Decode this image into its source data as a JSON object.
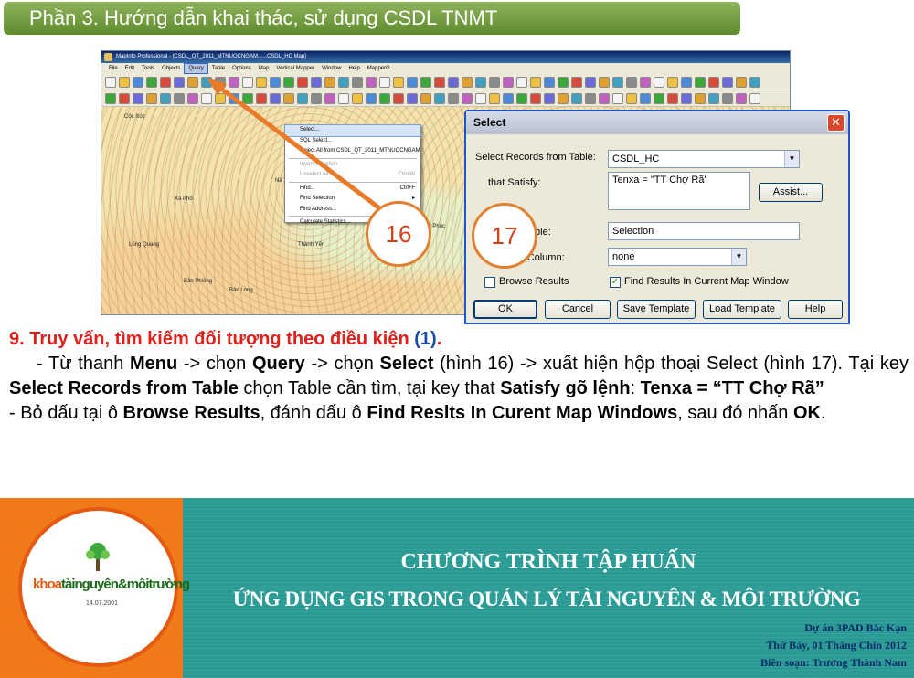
{
  "slide": {
    "title": "Phần 3. Hướng dẫn khai thác, sử dụng CSDL TNMT"
  },
  "app": {
    "window_title": "MapInfo Professional - [CSDL_QT_2011_MTNUOCNGAM,.....CSDL_HC Map]",
    "menu": [
      "File",
      "Edit",
      "Tools",
      "Objects",
      "Query",
      "Table",
      "Options",
      "Map",
      "Vertical Mapper",
      "Window",
      "Help",
      "MapperG"
    ],
    "active_menu": "Query",
    "query_menu_items": [
      {
        "label": "Select...",
        "shortcut": "",
        "disabled": false,
        "highlight": true
      },
      {
        "label": "SQL Select...",
        "shortcut": "",
        "disabled": false,
        "highlight": false
      },
      {
        "label": "Select All from CSDL_QT_2011_MTNUOCNGAM",
        "shortcut": "",
        "disabled": false,
        "highlight": false
      },
      {
        "label": "Invert Selection",
        "shortcut": "",
        "disabled": true,
        "highlight": false
      },
      {
        "label": "Unselect All",
        "shortcut": "Ctrl+W",
        "disabled": true,
        "highlight": false
      },
      {
        "label": "Find...",
        "shortcut": "Ctrl+F",
        "disabled": false,
        "highlight": false
      },
      {
        "label": "Find Selection",
        "shortcut": "▸",
        "disabled": false,
        "highlight": false
      },
      {
        "label": "Find Address...",
        "shortcut": "",
        "disabled": false,
        "highlight": false
      },
      {
        "label": "Calculate Statistics...",
        "shortcut": "",
        "disabled": false,
        "highlight": false
      }
    ],
    "map_labels": [
      "Cộc Xóc",
      "Xã Phố",
      "Bản Lòng",
      "Nà Phai",
      "Cẩm Giàng",
      "Xã Nậm",
      "Khuổi Nằm",
      "Nà Thanh Sơn",
      "Lũng Quang",
      "Phú Phúc",
      "Bản Phiêng",
      "Thành Yên"
    ]
  },
  "callouts": {
    "fig16": "16",
    "fig17": "17"
  },
  "dialog": {
    "title": "Select",
    "select_records_label": "Select Records from Table:",
    "table_value": "CSDL_HC",
    "satisfy_label": "that Satisfy:",
    "satisfy_value": "Tenxa = \"TT Chợ Rã\"",
    "assist_button": "Assist...",
    "results_label": "in Table:",
    "results_value": "Selection",
    "sort_label": "by Column:",
    "sort_value": "none",
    "browse_results_label": "Browse Results",
    "browse_results_checked": false,
    "find_results_label": "Find Results In Current Map Window",
    "find_results_checked": true,
    "buttons": {
      "ok": "OK",
      "cancel": "Cancel",
      "save_template": "Save Template",
      "load_template": "Load Template",
      "help": "Help"
    }
  },
  "content": {
    "heading": "9. Truy vấn, tìm kiếm đối tượng theo điều kiện ",
    "heading_ref": "(1)",
    "heading_end": ".",
    "p1_a": "- Từ thanh ",
    "p1_menu": "Menu",
    "p1_b": " -> chọn ",
    "p1_query": "Query",
    "p1_c": " -> chọn ",
    "p1_select": "Select",
    "p1_d": " (hình 16) -> xuất hiện hộp thoại Select (hình 17). Tại key  ",
    "p1_srt": "Select Records from Table",
    "p1_e": " chọn Table cần tìm, tại key that ",
    "p1_satisfy": "Satisfy gõ lệnh",
    "p1_f": ": ",
    "p1_cmd": "Tenxa = “TT Chợ Rã”",
    "p2_a": "- Bỏ dấu tại ô ",
    "p2_browse": "Browse Results",
    "p2_b": ", đánh dấu ô ",
    "p2_find": "Find Reslts In Curent Map Windows",
    "p2_c": ", sau đó nhấn ",
    "p2_ok": "OK",
    "p2_d": "."
  },
  "footer": {
    "logo_text_a": "khoa",
    "logo_text_b": "tàinguyên&môitrường",
    "logo_date": "14.07.2001",
    "title1": "CHƯƠNG TRÌNH TẬP HUẤN",
    "title2": "ỨNG DỤNG GIS TRONG QUẢN LÝ TÀI NGUYÊN & MÔI TRƯỜNG",
    "project": "Dự án 3PAD Bắc Kạn",
    "date": "Thứ Bảy, 01 Tháng Chín 2012",
    "author": "Biên soạn: Trương Thành Nam"
  },
  "colors": {
    "title_green": "#6f9a3a",
    "heading_red": "#e0201a",
    "callout_orange": "#e08030",
    "footer_teal": "#2a9a94",
    "footer_orange": "#f07a18"
  }
}
